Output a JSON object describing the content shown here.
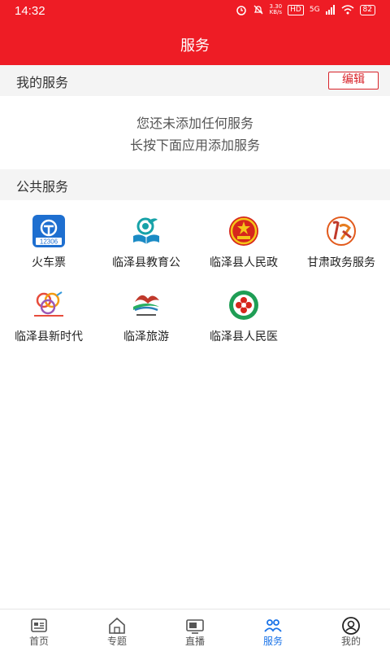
{
  "status": {
    "time": "14:32",
    "net_speed_value": "3.30",
    "net_speed_unit": "KB/s",
    "hd": "HD",
    "signal": "5G",
    "battery": "82"
  },
  "header": {
    "title": "服务"
  },
  "my_services": {
    "title": "我的服务",
    "edit_label": "编辑",
    "empty_line1": "您还未添加任何服务",
    "empty_line2": "长按下面应用添加服务"
  },
  "public_services": {
    "title": "公共服务",
    "items": [
      {
        "label": "火车票",
        "icon": "railway-12306-icon",
        "icon_text": "12306"
      },
      {
        "label": "临泽县教育公",
        "icon": "education-logo-icon"
      },
      {
        "label": "临泽县人民政",
        "icon": "national-emblem-icon"
      },
      {
        "label": "甘肃政务服务",
        "icon": "gansu-gov-service-icon"
      },
      {
        "label": "临泽县新时代",
        "icon": "new-era-logo-icon"
      },
      {
        "label": "临泽旅游",
        "icon": "tourism-logo-icon"
      },
      {
        "label": "临泽县人民医",
        "icon": "hospital-logo-icon"
      }
    ]
  },
  "tabs": [
    {
      "label": "首页",
      "icon": "news-icon",
      "active": false
    },
    {
      "label": "专题",
      "icon": "home-icon",
      "active": false
    },
    {
      "label": "直播",
      "icon": "tv-icon",
      "active": false
    },
    {
      "label": "服务",
      "icon": "people-icon",
      "active": true
    },
    {
      "label": "我的",
      "icon": "user-icon",
      "active": false
    }
  ],
  "colors": {
    "brand_red": "#ee1c25",
    "active_blue": "#1a73e8"
  }
}
